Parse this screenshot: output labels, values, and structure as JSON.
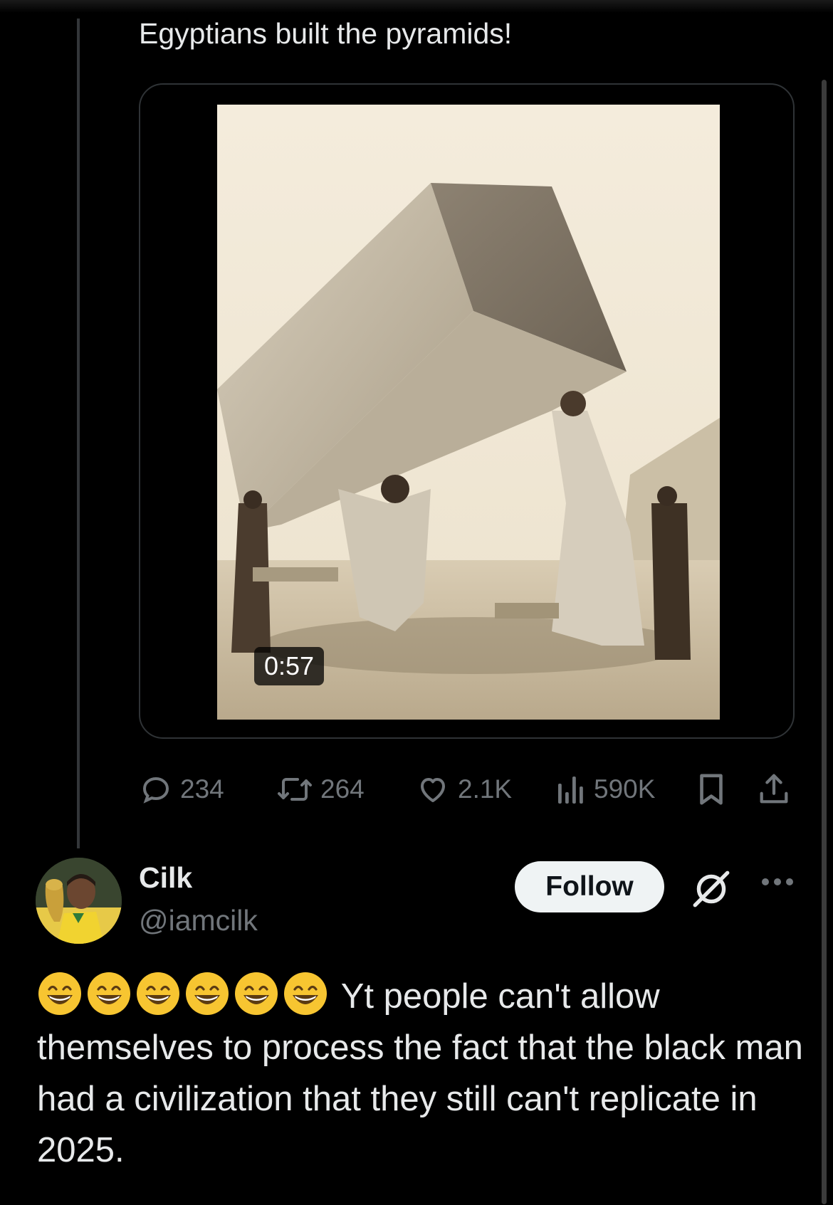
{
  "parent_tweet": {
    "text": "Egyptians built the pyramids!",
    "video_duration": "0:57",
    "stats": {
      "replies": "234",
      "reposts": "264",
      "likes": "2.1K",
      "views": "590K"
    }
  },
  "reply": {
    "display_name": "Cilk",
    "handle": "@iamcilk",
    "follow_label": "Follow",
    "emoji_count": 6,
    "text": "Yt people can't allow themselves to process the fact that the black man had a civilization that they still can't replicate in 2025."
  },
  "icons": {
    "reply": "reply-icon",
    "repost": "repost-icon",
    "like": "like-icon",
    "views": "views-icon",
    "bookmark": "bookmark-icon",
    "share": "share-icon",
    "grok": "grok-icon",
    "more": "more-icon",
    "emoji": "grinning-face-emoji"
  },
  "colors": {
    "background": "#000000",
    "text": "#e7e9ea",
    "muted": "#71767b",
    "follow_bg": "#eff3f4"
  }
}
